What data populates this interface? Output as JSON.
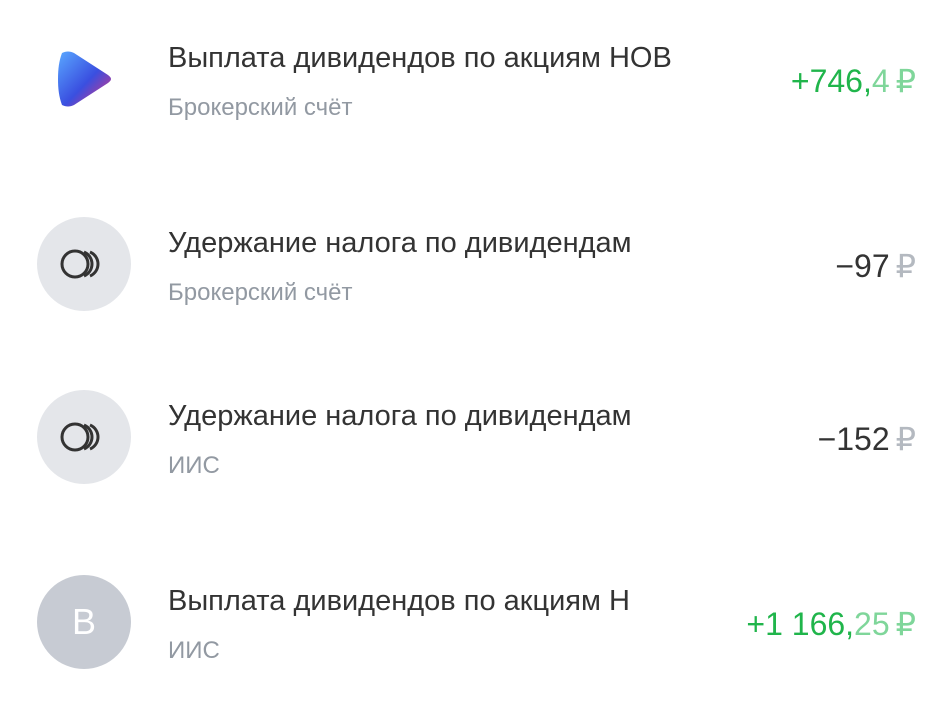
{
  "colors": {
    "positive": "#20b54b",
    "positive_light": "#7fd69a",
    "text": "#333333",
    "subtext": "#9299a2",
    "avatar_bg": "#e4e6ea",
    "avatar_letter_bg": "#c7cbd3"
  },
  "operations": [
    {
      "icon": "broker-logo-icon",
      "title": "Выплата дивидендов по акциям НОВ",
      "account": "Брокерский счёт",
      "amount_main": "+746,",
      "amount_fraction": "4",
      "currency": "₽"
    },
    {
      "icon": "coins-icon",
      "title": "Удержание налога по дивидендам",
      "account": "Брокерский счёт",
      "amount_main": "−97",
      "amount_fraction": "",
      "currency": "₽"
    },
    {
      "icon": "coins-icon",
      "title": "Удержание налога по дивидендам",
      "account": "ИИС",
      "amount_main": "−152",
      "amount_fraction": "",
      "currency": "₽"
    },
    {
      "icon": "letter-avatar",
      "avatar_letter": "В",
      "title": "Выплата дивидендов по акциям Н",
      "account": "ИИС",
      "amount_main": "+1 166,",
      "amount_fraction": "25",
      "currency": "₽"
    }
  ]
}
